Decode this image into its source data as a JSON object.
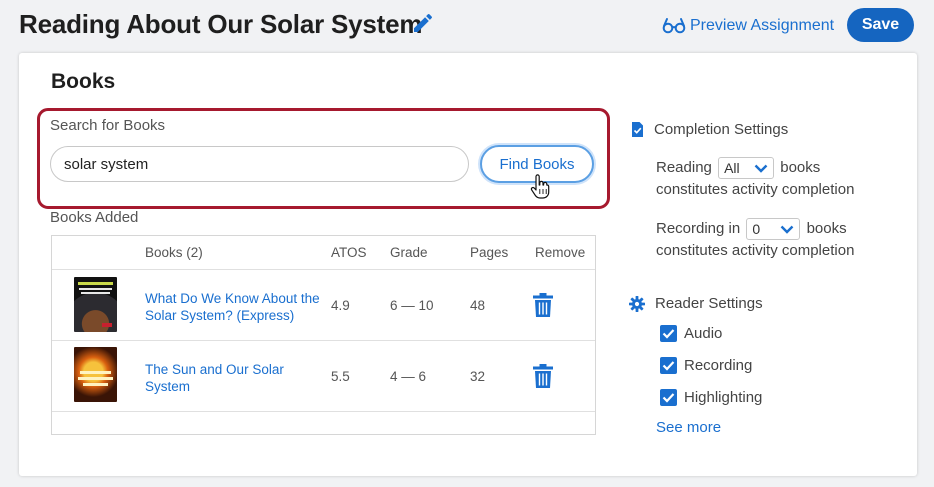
{
  "header": {
    "title": "Reading About Our Solar System",
    "preview_label": "Preview Assignment",
    "save_label": "Save"
  },
  "books_section": {
    "title": "Books",
    "search_label": "Search for Books",
    "search_value": "solar system",
    "find_button_label": "Find Books",
    "books_added_label": "Books Added",
    "table": {
      "headers": {
        "books": "Books (2)",
        "atos": "ATOS",
        "grade": "Grade",
        "pages": "Pages",
        "remove": "Remove"
      },
      "rows": [
        {
          "title": "What Do We Know About the Solar System? (Express)",
          "atos": "4.9",
          "grade": "6 — 10",
          "pages": "48",
          "cover_colors": [
            "#111111",
            "#2c2b30",
            "#7a4a2a"
          ]
        },
        {
          "title": "The Sun and Our Solar System",
          "atos": "5.5",
          "grade": "4 — 6",
          "pages": "32",
          "cover_colors": [
            "#3a1406",
            "#d9600f",
            "#f6c23c"
          ]
        }
      ]
    }
  },
  "completion_settings": {
    "heading": "Completion Settings",
    "reading_prefix": "Reading",
    "reading_value": "All",
    "reading_suffix": "books",
    "reading_line2": "constitutes activity completion",
    "recording_prefix": "Recording in",
    "recording_value": "0",
    "recording_suffix": "books",
    "recording_line2": "constitutes activity completion"
  },
  "reader_settings": {
    "heading": "Reader Settings",
    "options": [
      {
        "label": "Audio",
        "checked": true
      },
      {
        "label": "Recording",
        "checked": true
      },
      {
        "label": "Highlighting",
        "checked": true
      }
    ],
    "see_more_label": "See more"
  },
  "colors": {
    "accent": "#1a6fcf",
    "save_button": "#1565c0",
    "highlight_border": "#a6192e"
  },
  "icons": {
    "edit": "pencil-icon",
    "preview": "glasses-icon",
    "cursor": "hand-pointer-icon",
    "remove": "trash-icon",
    "completion": "checklist-icon",
    "reader": "gear-icon",
    "select": "chevron-down-icon",
    "checkbox": "checkmark-icon"
  }
}
